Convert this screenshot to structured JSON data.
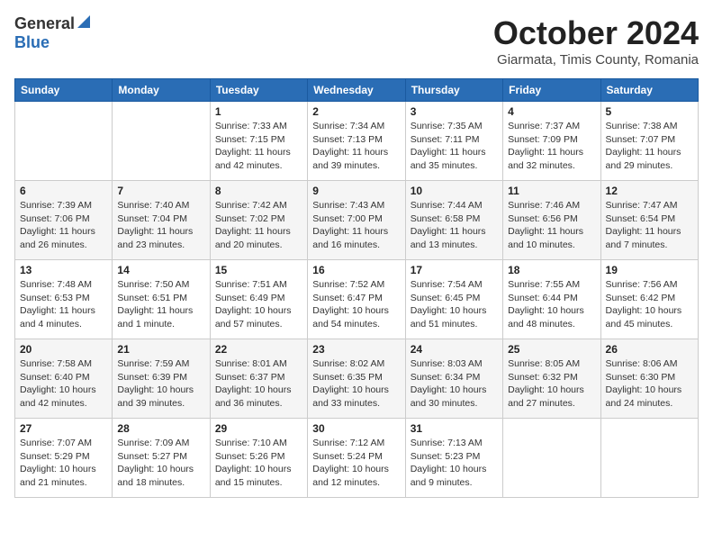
{
  "header": {
    "logo_general": "General",
    "logo_blue": "Blue",
    "month_title": "October 2024",
    "subtitle": "Giarmata, Timis County, Romania"
  },
  "calendar": {
    "days_of_week": [
      "Sunday",
      "Monday",
      "Tuesday",
      "Wednesday",
      "Thursday",
      "Friday",
      "Saturday"
    ],
    "weeks": [
      [
        {
          "day": "",
          "info": ""
        },
        {
          "day": "",
          "info": ""
        },
        {
          "day": "1",
          "info": "Sunrise: 7:33 AM\nSunset: 7:15 PM\nDaylight: 11 hours and 42 minutes."
        },
        {
          "day": "2",
          "info": "Sunrise: 7:34 AM\nSunset: 7:13 PM\nDaylight: 11 hours and 39 minutes."
        },
        {
          "day": "3",
          "info": "Sunrise: 7:35 AM\nSunset: 7:11 PM\nDaylight: 11 hours and 35 minutes."
        },
        {
          "day": "4",
          "info": "Sunrise: 7:37 AM\nSunset: 7:09 PM\nDaylight: 11 hours and 32 minutes."
        },
        {
          "day": "5",
          "info": "Sunrise: 7:38 AM\nSunset: 7:07 PM\nDaylight: 11 hours and 29 minutes."
        }
      ],
      [
        {
          "day": "6",
          "info": "Sunrise: 7:39 AM\nSunset: 7:06 PM\nDaylight: 11 hours and 26 minutes."
        },
        {
          "day": "7",
          "info": "Sunrise: 7:40 AM\nSunset: 7:04 PM\nDaylight: 11 hours and 23 minutes."
        },
        {
          "day": "8",
          "info": "Sunrise: 7:42 AM\nSunset: 7:02 PM\nDaylight: 11 hours and 20 minutes."
        },
        {
          "day": "9",
          "info": "Sunrise: 7:43 AM\nSunset: 7:00 PM\nDaylight: 11 hours and 16 minutes."
        },
        {
          "day": "10",
          "info": "Sunrise: 7:44 AM\nSunset: 6:58 PM\nDaylight: 11 hours and 13 minutes."
        },
        {
          "day": "11",
          "info": "Sunrise: 7:46 AM\nSunset: 6:56 PM\nDaylight: 11 hours and 10 minutes."
        },
        {
          "day": "12",
          "info": "Sunrise: 7:47 AM\nSunset: 6:54 PM\nDaylight: 11 hours and 7 minutes."
        }
      ],
      [
        {
          "day": "13",
          "info": "Sunrise: 7:48 AM\nSunset: 6:53 PM\nDaylight: 11 hours and 4 minutes."
        },
        {
          "day": "14",
          "info": "Sunrise: 7:50 AM\nSunset: 6:51 PM\nDaylight: 11 hours and 1 minute."
        },
        {
          "day": "15",
          "info": "Sunrise: 7:51 AM\nSunset: 6:49 PM\nDaylight: 10 hours and 57 minutes."
        },
        {
          "day": "16",
          "info": "Sunrise: 7:52 AM\nSunset: 6:47 PM\nDaylight: 10 hours and 54 minutes."
        },
        {
          "day": "17",
          "info": "Sunrise: 7:54 AM\nSunset: 6:45 PM\nDaylight: 10 hours and 51 minutes."
        },
        {
          "day": "18",
          "info": "Sunrise: 7:55 AM\nSunset: 6:44 PM\nDaylight: 10 hours and 48 minutes."
        },
        {
          "day": "19",
          "info": "Sunrise: 7:56 AM\nSunset: 6:42 PM\nDaylight: 10 hours and 45 minutes."
        }
      ],
      [
        {
          "day": "20",
          "info": "Sunrise: 7:58 AM\nSunset: 6:40 PM\nDaylight: 10 hours and 42 minutes."
        },
        {
          "day": "21",
          "info": "Sunrise: 7:59 AM\nSunset: 6:39 PM\nDaylight: 10 hours and 39 minutes."
        },
        {
          "day": "22",
          "info": "Sunrise: 8:01 AM\nSunset: 6:37 PM\nDaylight: 10 hours and 36 minutes."
        },
        {
          "day": "23",
          "info": "Sunrise: 8:02 AM\nSunset: 6:35 PM\nDaylight: 10 hours and 33 minutes."
        },
        {
          "day": "24",
          "info": "Sunrise: 8:03 AM\nSunset: 6:34 PM\nDaylight: 10 hours and 30 minutes."
        },
        {
          "day": "25",
          "info": "Sunrise: 8:05 AM\nSunset: 6:32 PM\nDaylight: 10 hours and 27 minutes."
        },
        {
          "day": "26",
          "info": "Sunrise: 8:06 AM\nSunset: 6:30 PM\nDaylight: 10 hours and 24 minutes."
        }
      ],
      [
        {
          "day": "27",
          "info": "Sunrise: 7:07 AM\nSunset: 5:29 PM\nDaylight: 10 hours and 21 minutes."
        },
        {
          "day": "28",
          "info": "Sunrise: 7:09 AM\nSunset: 5:27 PM\nDaylight: 10 hours and 18 minutes."
        },
        {
          "day": "29",
          "info": "Sunrise: 7:10 AM\nSunset: 5:26 PM\nDaylight: 10 hours and 15 minutes."
        },
        {
          "day": "30",
          "info": "Sunrise: 7:12 AM\nSunset: 5:24 PM\nDaylight: 10 hours and 12 minutes."
        },
        {
          "day": "31",
          "info": "Sunrise: 7:13 AM\nSunset: 5:23 PM\nDaylight: 10 hours and 9 minutes."
        },
        {
          "day": "",
          "info": ""
        },
        {
          "day": "",
          "info": ""
        }
      ]
    ]
  }
}
